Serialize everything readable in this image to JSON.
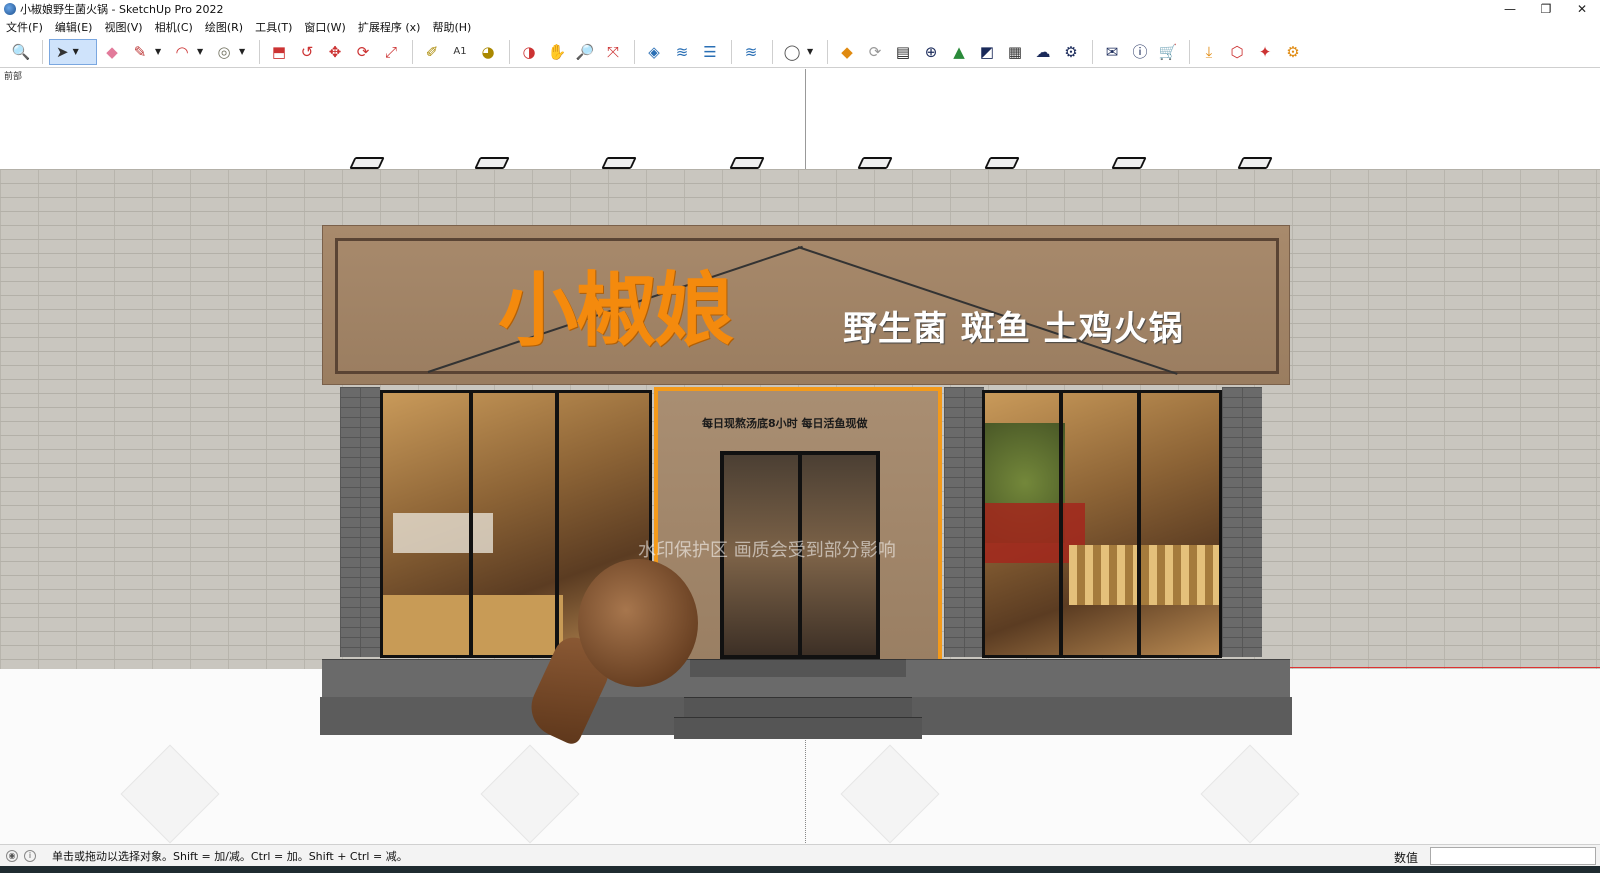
{
  "window": {
    "title": "小椒娘野生菌火锅 - SketchUp Pro 2022",
    "controls": {
      "minimize": "—",
      "maximize": "❐",
      "close": "✕"
    }
  },
  "menu": [
    "文件(F)",
    "编辑(E)",
    "视图(V)",
    "相机(C)",
    "绘图(R)",
    "工具(T)",
    "窗口(W)",
    "扩展程序 (x)",
    "帮助(H)"
  ],
  "toolbar": {
    "groups": [
      [
        "zoom-icon"
      ],
      [
        "select-icon",
        "eraser-icon",
        "pencil-icon",
        "arc-icon",
        "tape-icon"
      ],
      [
        "pushpull-icon",
        "followme-icon",
        "move-icon",
        "rotate-icon",
        "scale-icon"
      ],
      [
        "paint-icon",
        "text-icon",
        "material-icon"
      ],
      [
        "section-icon",
        "hand-icon",
        "zoomwin-icon",
        "zoomext-icon"
      ],
      [
        "layer-icon",
        "wave-icon",
        "stack-icon"
      ],
      [
        "wave2-icon"
      ],
      [
        "user-icon"
      ],
      [
        "extension-icon",
        "refresh-icon",
        "film-icon",
        "plus-circle-icon",
        "tree-icon",
        "chart-icon",
        "checker-icon",
        "cloud-icon",
        "gears-icon"
      ],
      [
        "mail-icon",
        "info-icon",
        "cart-icon"
      ],
      [
        "import-icon",
        "extract-icon",
        "plugin-icon",
        "gear-orange-icon"
      ]
    ]
  },
  "viewport": {
    "scene_label": "前部",
    "sign": {
      "main": "小椒娘",
      "sub": "野生菌 斑鱼 土鸡火锅"
    },
    "entrance_slogan": "每日现熬汤底8小时  每日活鱼现做",
    "watermark": "水印保护区    画质会受到部分影响"
  },
  "statusbar": {
    "hint": "单击或拖动以选择对象。Shift = 加/减。Ctrl = 加。Shift + Ctrl = 减。",
    "measurement_label": "数值",
    "measurement_value": ""
  }
}
